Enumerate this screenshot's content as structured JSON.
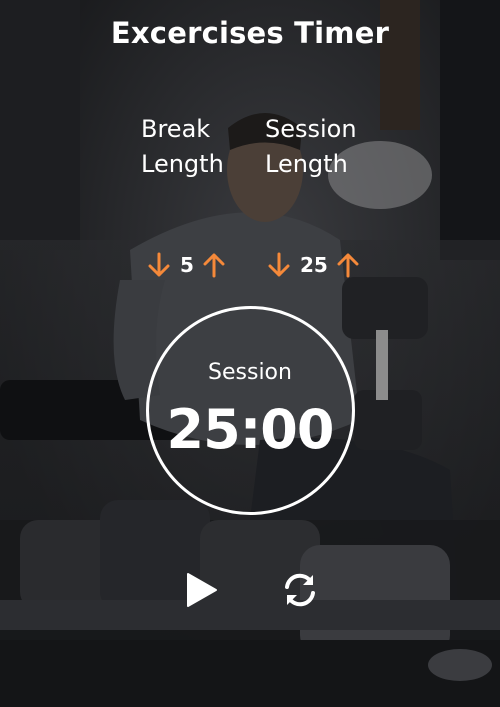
{
  "app": {
    "title": "Excercises Timer"
  },
  "break": {
    "label": "Break Length",
    "value": "5",
    "decrement_icon": "arrow-down-icon",
    "increment_icon": "arrow-up-icon"
  },
  "session": {
    "label": "Session Length",
    "value": "25",
    "decrement_icon": "arrow-down-icon",
    "increment_icon": "arrow-up-icon"
  },
  "timer": {
    "label": "Session",
    "display": "25:00"
  },
  "controls": {
    "play_icon": "play-icon",
    "reset_icon": "refresh-icon"
  },
  "colors": {
    "accent": "#f5893a",
    "text": "#ffffff",
    "background": "#1e1f22"
  }
}
